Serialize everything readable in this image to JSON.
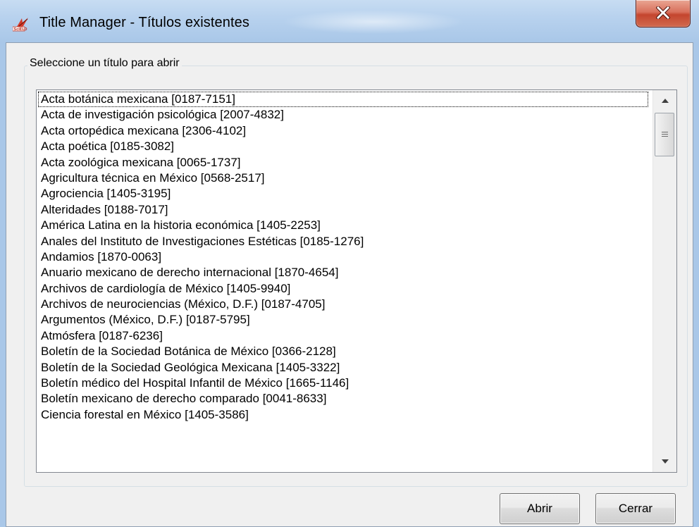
{
  "window": {
    "title": "Title Manager - Títulos existentes",
    "app_icon": "scielo-logo-icon",
    "close_icon": "close-x-icon",
    "close_color": "#c7432c"
  },
  "group": {
    "label": "Seleccione un título para abrir"
  },
  "list": {
    "focused_index": 0,
    "items": [
      "Acta botánica mexicana [0187-7151]",
      "Acta de investigación psicológica [2007-4832]",
      "Acta ortopédica mexicana [2306-4102]",
      "Acta poética [0185-3082]",
      "Acta zoológica mexicana [0065-1737]",
      "Agricultura técnica en México [0568-2517]",
      "Agrociencia [1405-3195]",
      "Alteridades [0188-7017]",
      "América Latina en la historia económica [1405-2253]",
      "Anales del Instituto de Investigaciones Estéticas [0185-1276]",
      "Andamios [1870-0063]",
      "Anuario mexicano de derecho internacional [1870-4654]",
      "Archivos de cardiología de México [1405-9940]",
      "Archivos de neurociencias (México, D.F.) [0187-4705]",
      "Argumentos (México, D.F.) [0187-5795]",
      "Atmósfera [0187-6236]",
      "Boletín de la Sociedad Botánica de México [0366-2128]",
      "Boletín de la Sociedad Geológica Mexicana [1405-3322]",
      "Boletín médico del Hospital Infantil de México [1665-1146]",
      "Boletín mexicano de derecho comparado [0041-8633]",
      "Ciencia forestal en México [1405-3586]"
    ],
    "scroll_position": 0
  },
  "buttons": {
    "open_label": "Abrir",
    "close_label": "Cerrar"
  }
}
